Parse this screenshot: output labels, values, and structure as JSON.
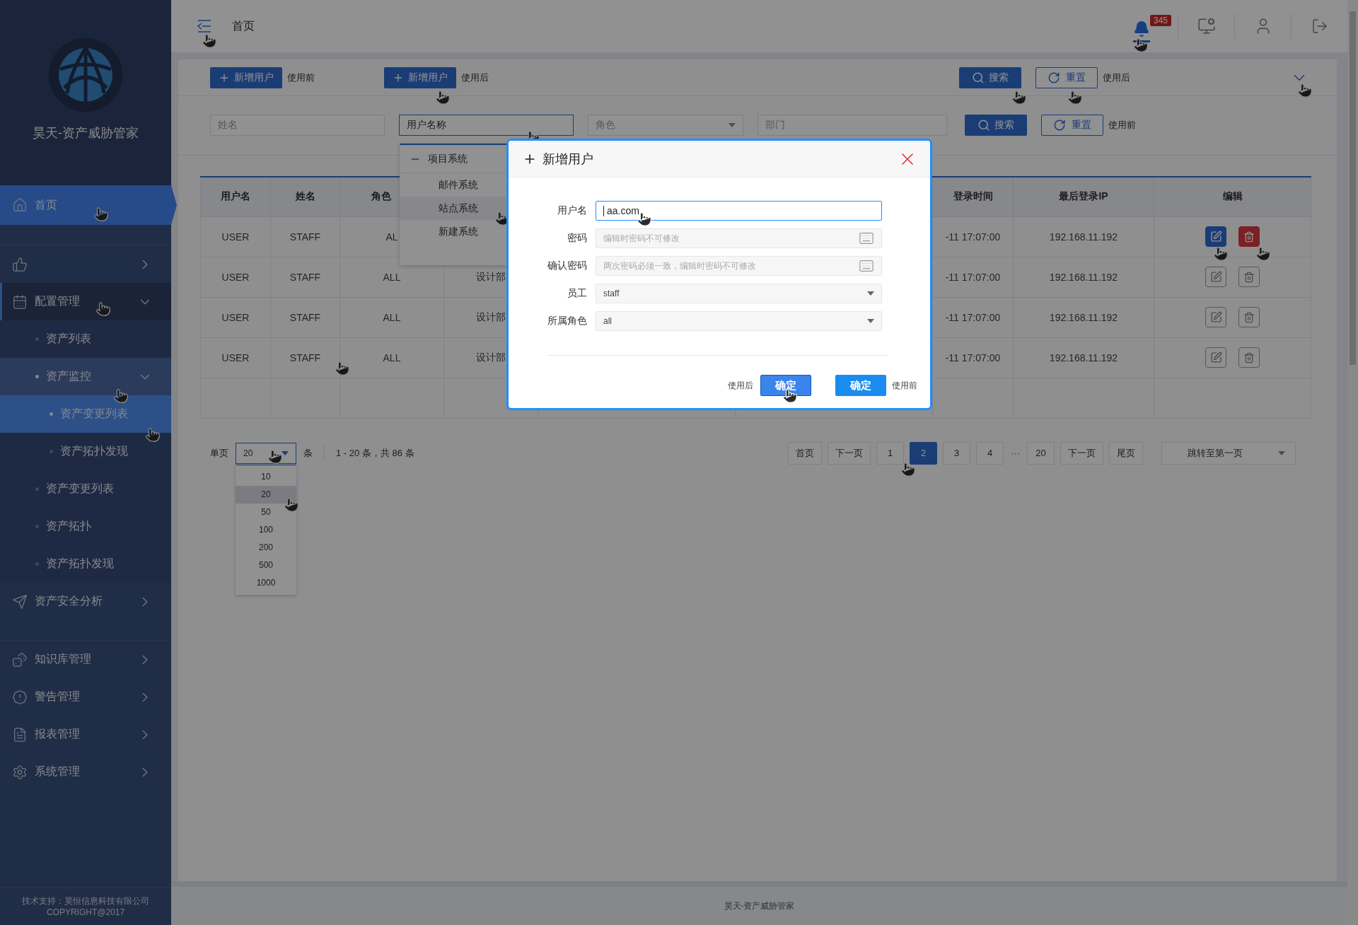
{
  "sidebar": {
    "app_title": "昊天-资产威胁管家",
    "sections": [
      [
        {
          "label": "首页",
          "selected": true
        }
      ],
      [
        {
          "selected": false,
          "expanded": false
        },
        {
          "label": "配置管理",
          "selected": false,
          "expanded": true,
          "children": [
            {
              "label": "资产列表",
              "selected": false
            },
            {
              "label": "资产监控",
              "selected": false,
              "expanded": true,
              "children": [
                {
                  "label": "资产变更列表",
                  "selected": true
                },
                {
                  "label": "资产拓扑发现",
                  "selected": false
                }
              ]
            },
            {
              "label": "资产变更列表",
              "selected": false
            },
            {
              "label": "资产拓扑",
              "selected": false
            },
            {
              "label": "资产拓扑发现",
              "selected": false
            }
          ]
        },
        {
          "label": "资产安全分析",
          "selected": false,
          "expanded": false
        }
      ],
      [
        {
          "label": "知识库管理",
          "selected": false,
          "expanded": false
        },
        {
          "label": "警告管理",
          "selected": false,
          "expanded": false
        },
        {
          "label": "报表管理",
          "selected": false,
          "expanded": false
        },
        {
          "label": "系统管理",
          "selected": false,
          "expanded": false
        }
      ]
    ],
    "footer": [
      "技术支持：昊恒信息科技有限公司",
      "COPYRIGHT@2017"
    ]
  },
  "topbar": {
    "breadcrumb": "首页",
    "notification_count": "345"
  },
  "toolbar": {
    "add_buttons": [
      {
        "label": "新增用户",
        "note": "使用前"
      },
      {
        "label": "新增用户",
        "note": "使用后"
      }
    ],
    "search_label": "搜索",
    "reset_label": "重置",
    "note": "使用后"
  },
  "filters": {
    "fields": [
      {
        "kind": "text",
        "placeholder": "姓名",
        "focused": false
      },
      {
        "kind": "text",
        "value": "用户名称",
        "focused": true
      },
      {
        "kind": "select",
        "placeholder": "角色",
        "focused": false
      },
      {
        "kind": "text",
        "placeholder": "部门",
        "focused": false
      }
    ],
    "search_label": "搜索",
    "reset_label": "重置",
    "note": "使用前"
  },
  "tree_dropdown": {
    "label": "项目系统",
    "expanded": true,
    "children": [
      {
        "label": "邮件系统",
        "selected": false
      },
      {
        "label": "站点系统",
        "selected": true
      },
      {
        "label": "新建系统",
        "selected": false
      }
    ]
  },
  "table": {
    "columns": {
      "username": "用户名",
      "name": "姓名",
      "role": "角色",
      "login_time": "登录时间",
      "ip": "最后登录IP",
      "actions": "编辑"
    },
    "rows": [
      {
        "username": "USER",
        "name": "STAFF",
        "role": "AL",
        "login_time": "-11 17:07:00",
        "ip": "192.168.11.192",
        "highlighted": true
      },
      {
        "username": "USER",
        "name": "STAFF",
        "role": "ALL",
        "department": "设计部",
        "login_time": "-11 17:07:00",
        "ip": "192.168.11.192",
        "highlighted": false
      },
      {
        "username": "USER",
        "name": "STAFF",
        "role": "ALL",
        "department": "设计部",
        "login_time": "-11 17:07:00",
        "ip": "192.168.11.192",
        "highlighted": false
      },
      {
        "username": "USER",
        "name": "STAFF",
        "role": "ALL",
        "department": "设计部",
        "login_time": "-11 17:07:00",
        "ip": "192.168.11.192",
        "highlighted": false
      }
    ]
  },
  "pagination": {
    "size_label": "单页",
    "size_value": "20",
    "unit": "条",
    "summary": "1 - 20 条，共 86 条",
    "size_options": [
      {
        "label": "10",
        "selected": false
      },
      {
        "label": "20",
        "selected": true
      },
      {
        "label": "50",
        "selected": false
      },
      {
        "label": "100",
        "selected": false
      },
      {
        "label": "200",
        "selected": false
      },
      {
        "label": "500",
        "selected": false
      },
      {
        "label": "1000",
        "selected": false
      }
    ],
    "buttons": [
      {
        "kind": "nav",
        "label": "首页"
      },
      {
        "kind": "nav",
        "label": "下一页"
      },
      {
        "kind": "page",
        "label": "1",
        "selected": false
      },
      {
        "kind": "page",
        "label": "2",
        "selected": true
      },
      {
        "kind": "page",
        "label": "3",
        "selected": false
      },
      {
        "kind": "page",
        "label": "4",
        "selected": false
      },
      {
        "kind": "ellipsis",
        "label": "···"
      },
      {
        "kind": "page",
        "label": "20",
        "selected": false
      },
      {
        "kind": "nav",
        "label": "下一页"
      },
      {
        "kind": "nav",
        "label": "尾页"
      }
    ],
    "jump": "跳转至第一页"
  },
  "modal": {
    "title": "新增用户",
    "fields": [
      {
        "kind": "text",
        "label": "用户名",
        "value": "aa.com",
        "focused": true
      },
      {
        "kind": "password",
        "label": "密码",
        "placeholder": "编辑时密码不可修改"
      },
      {
        "kind": "password",
        "label": "确认密码",
        "placeholder": "两次密码必须一致，编辑时密码不可修改"
      },
      {
        "kind": "select",
        "label": "员工",
        "value": "staff"
      },
      {
        "kind": "select",
        "label": "所属角色",
        "value": "all"
      }
    ],
    "footer": [
      {
        "kind": "note",
        "text": "使用后"
      },
      {
        "kind": "button",
        "label": "确定",
        "hovered": true
      },
      {
        "kind": "button",
        "label": "确定",
        "hovered": false
      },
      {
        "kind": "note",
        "text": "使用前"
      }
    ]
  },
  "page_footer": "昊天-资产威胁管家"
}
